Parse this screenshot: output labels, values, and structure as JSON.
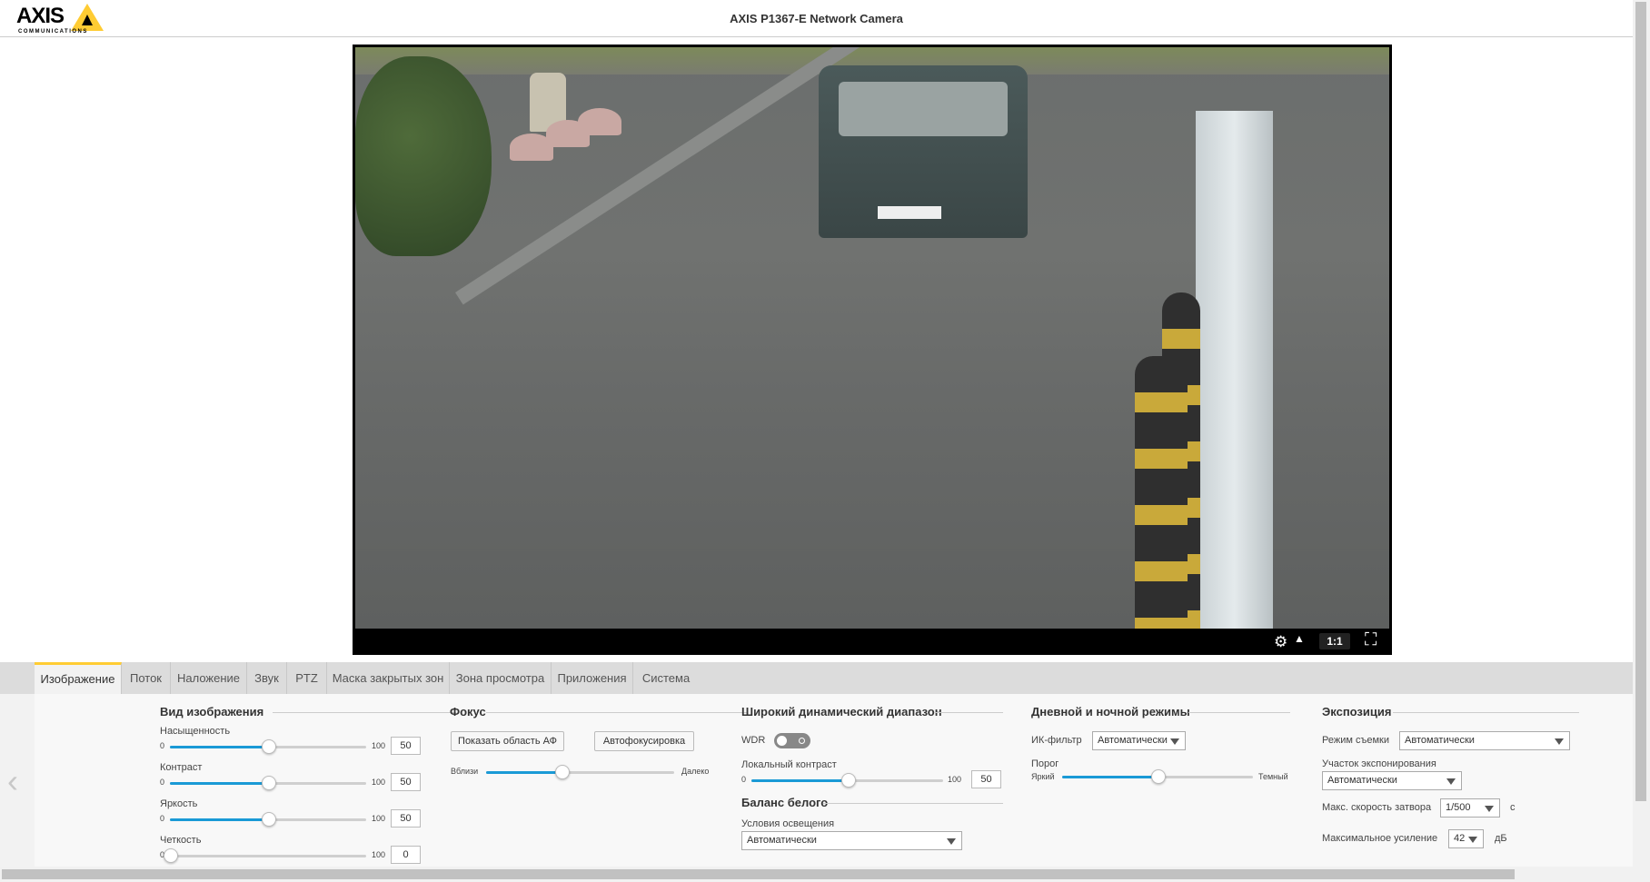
{
  "header": {
    "title": "AXIS P1367-E Network Camera",
    "logo_text": "AXIS",
    "logo_sub": "COMMUNICATIONS"
  },
  "video": {
    "ratio_label": "1:1"
  },
  "tabs": [
    {
      "label": "Изображение"
    },
    {
      "label": "Поток"
    },
    {
      "label": "Наложение"
    },
    {
      "label": "Звук"
    },
    {
      "label": "PTZ"
    },
    {
      "label": "Маска закрытых зон"
    },
    {
      "label": "Зона просмотра"
    },
    {
      "label": "Приложения"
    },
    {
      "label": "Система"
    }
  ],
  "image_view": {
    "title": "Вид изображения",
    "sliders": [
      {
        "label": "Насыщенность",
        "min": "0",
        "max": "100",
        "value": "50",
        "fraction": 0.5
      },
      {
        "label": "Контраст",
        "min": "0",
        "max": "100",
        "value": "50",
        "fraction": 0.5
      },
      {
        "label": "Яркость",
        "min": "0",
        "max": "100",
        "value": "50",
        "fraction": 0.5
      },
      {
        "label": "Четкость",
        "min": "0",
        "max": "100",
        "value": "0",
        "fraction": 0.0
      }
    ]
  },
  "focus": {
    "title": "Фокус",
    "show_af_area_label": "Показать область АФ",
    "autofocus_label": "Автофокусировка",
    "near_label": "Вблизи",
    "far_label": "Далеко",
    "fraction": 0.4
  },
  "wdr": {
    "title": "Широкий динамический диапазон",
    "wdr_label": "WDR",
    "local_contrast_label": "Локальный контраст",
    "min": "0",
    "max": "100",
    "value": "50",
    "fraction": 0.5
  },
  "white_balance": {
    "title": "Баланс белого",
    "conditions_label": "Условия освещения",
    "conditions_value": "Автоматически"
  },
  "day_night": {
    "title": "Дневной и ночной режимы",
    "ir_filter_label": "ИК-фильтр",
    "ir_filter_value": "Автоматически",
    "threshold_label": "Порог",
    "bright_label": "Яркий",
    "dark_label": "Темный",
    "fraction": 0.5
  },
  "exposure": {
    "title": "Экспозиция",
    "mode_label": "Режим съемки",
    "mode_value": "Автоматически",
    "zone_label": "Участок экспонирования",
    "zone_value": "Автоматически",
    "shutter_label": "Макс. скорость затвора",
    "shutter_value": "1/500",
    "shutter_unit": "с",
    "gain_label": "Максимальное усиление",
    "gain_value": "42",
    "gain_unit": "дБ"
  }
}
